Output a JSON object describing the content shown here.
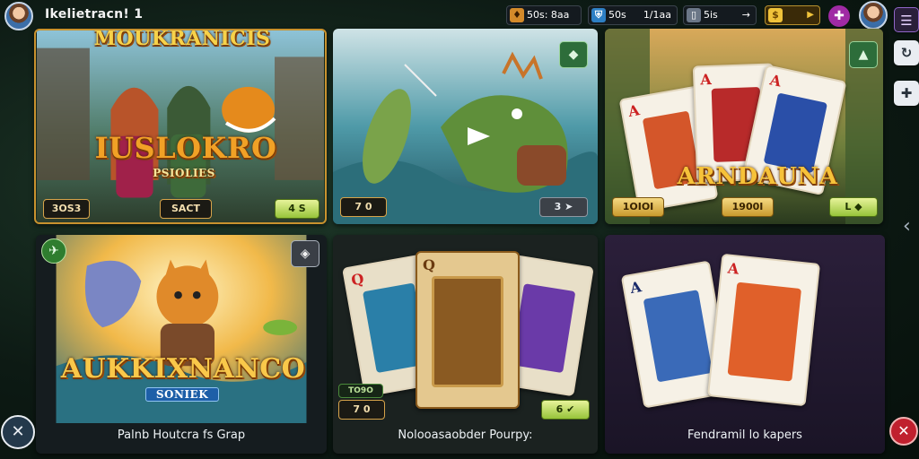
{
  "topbar": {
    "player_name": "Ikelietracn! 1",
    "resources": [
      {
        "icon": "fire-gem-icon",
        "glyph": "♦",
        "value": "50s: 8aa"
      },
      {
        "icon": "shield-icon",
        "glyph": "⛨",
        "value": "50s",
        "value2": "1/1aa"
      },
      {
        "icon": "card-icon",
        "glyph": "▯",
        "value": "5is",
        "value2": "→"
      },
      {
        "icon": "gold-coin-icon",
        "glyph": "$",
        "value2": "▶"
      }
    ],
    "plus_glyph": "✚"
  },
  "rail": {
    "menu_glyph": "☰",
    "refresh_glyph": "↻",
    "plus_glyph": "✚",
    "chevron_glyph": "‹"
  },
  "corners": {
    "bottom_left_glyph": "✕",
    "bottom_right_glyph": "✕"
  },
  "tiles": [
    {
      "id": "t1",
      "title_top": "MOUKRANICIS",
      "title_main": "IUSLOKRO",
      "title_sub": "PSIOLIES",
      "left_pill": "3OS3",
      "mid_pill": "SACT",
      "right_pill": "4 S"
    },
    {
      "id": "t2",
      "corner_glyph": "◆",
      "left_pill": "7 0",
      "right_pill": "3 ➤"
    },
    {
      "id": "t3",
      "corner_glyph": "▲",
      "title_main": "ARNDAUNA",
      "left_pill": "1OIOI",
      "mid_pill": "1900I",
      "right_pill": "L ◆"
    },
    {
      "id": "t4",
      "corner_glyph": "◈",
      "title_main": "AUKKIXNANCO",
      "title_sub": "SONIEK",
      "caption": "Palnb Houtcra fs Grap",
      "corner_left_glyph": "✈"
    },
    {
      "id": "t5",
      "small_label": "TO9O",
      "left_pill": "7 0",
      "right_pill": "6 ✔",
      "caption": "Nolooasaobder Pourpy:"
    },
    {
      "id": "t6",
      "caption": "Fendramil lo kapers"
    }
  ],
  "colors": {
    "accent_gold": "#f7d24a",
    "pill_green": "#97c43a",
    "plus_purple": "#a02aa4",
    "alert_red": "#c0202e"
  }
}
